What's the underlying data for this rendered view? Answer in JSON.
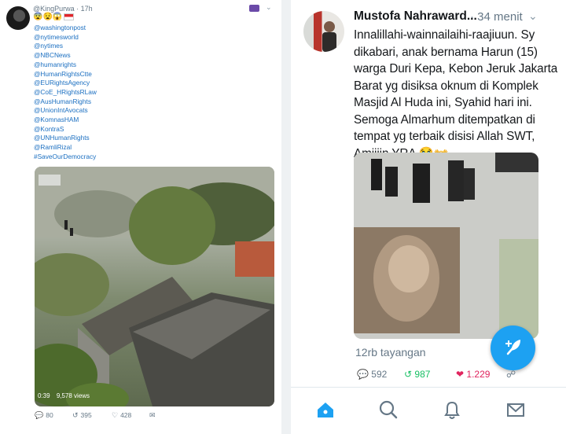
{
  "left_tweet": {
    "handle": "@KingPurwa",
    "time": "17h",
    "name_line": "@KingPurwa · 17h",
    "emojis": "😨😧😱",
    "mentions": [
      "@washingtonpost",
      "@nytimesworld",
      "@nytimes",
      "@NBCNews",
      "@humanrights",
      "@HumanRightsCtte",
      "@EURightsAgency",
      "@CoE_HRightsRLaw",
      "@AusHumanRights",
      "@UnionIntAvocats",
      "@KomnasHAM",
      "@KontraS",
      "@UNHumanRights",
      "@RamliRizal",
      "#SaveOurDemocracy"
    ],
    "video": {
      "duration": "0:39",
      "views": "9,578 views"
    },
    "stats": {
      "replies": "80",
      "retweets": "395",
      "likes": "428"
    }
  },
  "right_tweet": {
    "name": "Mustofa Nahraward...",
    "time": "· 34 menit",
    "text": "Innalillahi-wainnailaihi-raajiuun. Sy dikabari, anak bernama Harun (15) warga Duri Kepa, Kebon Jeruk Jakarta Barat yg disiksa oknum di Komplek Masjid Al Huda ini, Syahid hari ini. Semoga Almarhum ditempatkan di tempat yg terbaik disisi Allah SWT, Amiiiin YRA 😭👐",
    "views": "12rb tayangan",
    "stats": {
      "replies": "592",
      "retweets": "987",
      "likes": "1.229"
    },
    "colors": {
      "accent": "#1da1f2",
      "retweet": "#17bf63",
      "like": "#e0245e"
    }
  },
  "nav": {
    "items": [
      "home-icon",
      "search-icon",
      "notifications-icon",
      "messages-icon"
    ]
  }
}
